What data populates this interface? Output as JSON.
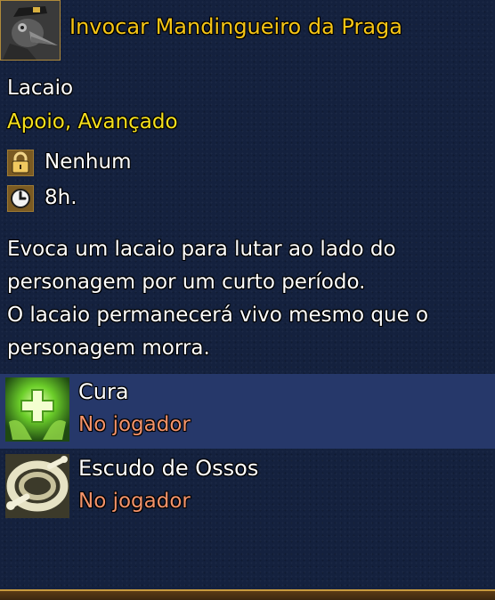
{
  "header": {
    "title": "Invocar Mandingueiro da Praga",
    "portrait_icon": "plague-doctor-portrait-icon"
  },
  "card": {
    "type": "Lacaio",
    "tags": "Apoio, Avançado"
  },
  "stats": [
    {
      "icon": "lock-icon",
      "value": "Nenhum"
    },
    {
      "icon": "clock-icon",
      "value": "8h."
    }
  ],
  "description": [
    "Evoca um lacaio para lutar ao lado do",
    "personagem por um curto período.",
    "O lacaio permanecerá vivo mesmo que o",
    "personagem morra."
  ],
  "abilities": [
    {
      "name": "Cura",
      "target": "No jogador",
      "icon": "heal-icon",
      "selected": true
    },
    {
      "name": "Escudo de Ossos",
      "target": "No jogador",
      "icon": "bone-shield-icon",
      "selected": false
    }
  ],
  "colors": {
    "title": "#f6c515",
    "tags": "#f6e01c",
    "target": "#f4936a",
    "background": "#14213e",
    "selected_row": "#26386a"
  }
}
